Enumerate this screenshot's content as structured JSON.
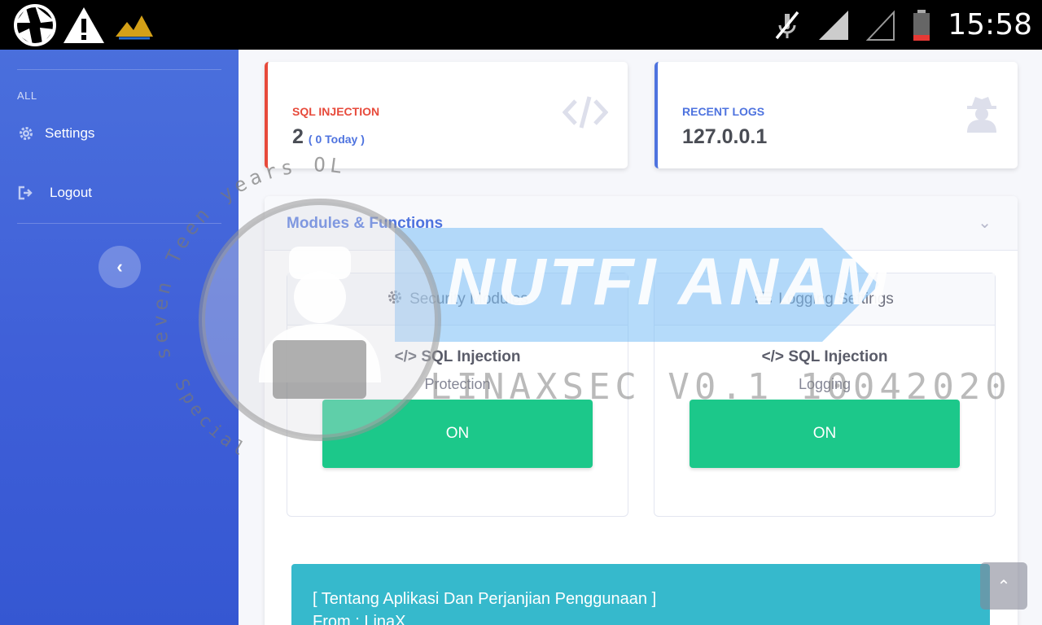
{
  "status_bar": {
    "time": "15:58",
    "icons": [
      "aperture-icon",
      "warning-icon",
      "app-logo",
      "mute-icon",
      "signal-icon",
      "no-signal-icon",
      "battery-low-icon"
    ]
  },
  "sidebar": {
    "heading": "ALL",
    "items": [
      {
        "label": "Settings",
        "icon": "gear-icon"
      },
      {
        "label": "Logout",
        "icon": "logout-icon"
      }
    ],
    "collapse_glyph": "‹"
  },
  "cards": [
    {
      "label": "SQL INJECTION",
      "value": "2",
      "sub": "( 0 Today )",
      "icon": "code-icon",
      "accent": "#e74a3b"
    },
    {
      "label": "RECENT LOGS",
      "value": "127.0.0.1",
      "icon": "user-secret-icon",
      "accent": "#4e73df"
    }
  ],
  "modules": {
    "title": "Modules & Functions",
    "panels": [
      {
        "header": "Security Modules",
        "header_icon": "gear-icon",
        "feature": "SQL Injection",
        "feature_sub": "Protection",
        "toggle": "ON"
      },
      {
        "header": "Logging Settings",
        "header_icon": "list-icon",
        "feature": "SQL Injection",
        "feature_sub": "Logging",
        "toggle": "ON"
      }
    ]
  },
  "about": {
    "line1": "[ Tentang Aplikasi Dan Perjanjian Penggunaan ]",
    "line2": "From : LinaX"
  },
  "watermark": {
    "title": "NUTFI ANAM",
    "version": "LINAXSEC V0.1 10042020",
    "ring_top": "seven Teen years OLD",
    "ring_bottom": "Special"
  },
  "colors": {
    "sidebar": "#4a6fdc",
    "danger": "#e74a3b",
    "primary": "#4e73df",
    "success": "#1cc88a",
    "info": "#36b9cc"
  }
}
